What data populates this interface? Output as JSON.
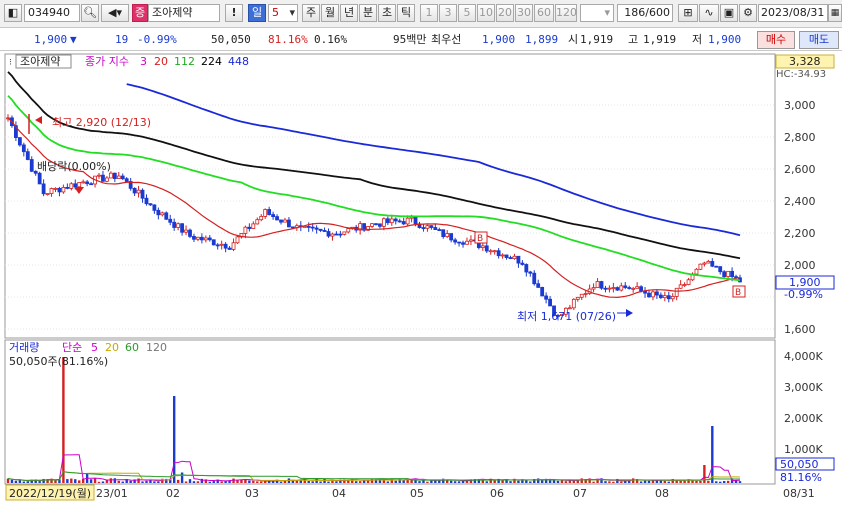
{
  "toolbar": {
    "code": "034940",
    "stock_badge": "증",
    "stock_name": "조아제약",
    "warn": "!",
    "period_selected": "일",
    "period_num": "5",
    "periods": [
      "주",
      "월",
      "년",
      "분",
      "초",
      "틱"
    ],
    "nums": [
      "1",
      "3",
      "5",
      "10",
      "20",
      "30",
      "60",
      "120"
    ],
    "count": "186",
    "total": "/600",
    "date": "2023/08/31"
  },
  "info": {
    "price": "1,900",
    "change": "19",
    "change_pct": "-0.99%",
    "volume": "50,050",
    "vol_ratio": "81.16%",
    "turnover": "0.16%",
    "label_95": "95백만",
    "best_label": "최우선",
    "best_ask": "1,900",
    "best_bid": "1,899",
    "open_label": "시",
    "open": "1,919",
    "high_label": "고",
    "high": "1,919",
    "low_label": "저",
    "low": "1,900",
    "buy_btn": "매수",
    "sell_btn": "매도"
  },
  "chart": {
    "title_box": "조아제약",
    "legend_label": "종가 지수",
    "legend_periods": [
      "3",
      "20",
      "112",
      "224",
      "448"
    ],
    "legend_colors": [
      "#cc00cc",
      "#d42020",
      "#22cc22",
      "#000000",
      "#1a2ad8"
    ],
    "max_annot": "최고 2,920 (12/13)",
    "dividend_annot": "배당락(0.00%)",
    "min_annot": "최저 1,671 (07/26)",
    "price_axis": [
      "3,000",
      "2,800",
      "2,600",
      "2,400",
      "2,200",
      "2,000",
      "1,800",
      "1,600"
    ],
    "top_box": "3,328",
    "hc_label": "HC:-34.93",
    "current_price_label": "1,900",
    "current_change_label": "-0.99%",
    "b_marker": "B"
  },
  "volume_panel": {
    "legend_label": "거래량",
    "legend_type": "단순",
    "legend_periods": [
      "5",
      "20",
      "60",
      "120"
    ],
    "legend_colors": [
      "#cc00cc",
      "#c8a800",
      "#2a9a2a",
      "#777777"
    ],
    "value_label": "50,050주(81.16%)",
    "axis": [
      "4,000K",
      "3,000K",
      "2,000K",
      "1,000K"
    ],
    "current_box": "50,050",
    "current_pct": "81.16%"
  },
  "xaxis": {
    "cursor_date": "2022/12/19(월)",
    "labels": [
      "23/01",
      "02",
      "03",
      "04",
      "05",
      "06",
      "07",
      "08"
    ],
    "end_label": "08/31"
  },
  "chart_data": {
    "type": "candlestick",
    "series": [
      {
        "name": "종가",
        "x": [
          "12/13",
          "12/19",
          "01/10",
          "02/01",
          "02/20",
          "03/10",
          "03/20",
          "04/10",
          "04/25",
          "05/15",
          "05/30",
          "06/15",
          "06/30",
          "07/10",
          "07/20",
          "07/26",
          "08/05",
          "08/15",
          "08/22",
          "08/28",
          "08/31"
        ],
        "values": [
          2920,
          2450,
          2520,
          2560,
          2350,
          2180,
          2120,
          2330,
          2220,
          2200,
          2260,
          2280,
          2180,
          2120,
          2020,
          1671,
          1880,
          1860,
          1780,
          2010,
          1900
        ]
      }
    ],
    "ylim": [
      1600,
      3000
    ],
    "volume_ylim_k": [
      0,
      4500
    ]
  }
}
